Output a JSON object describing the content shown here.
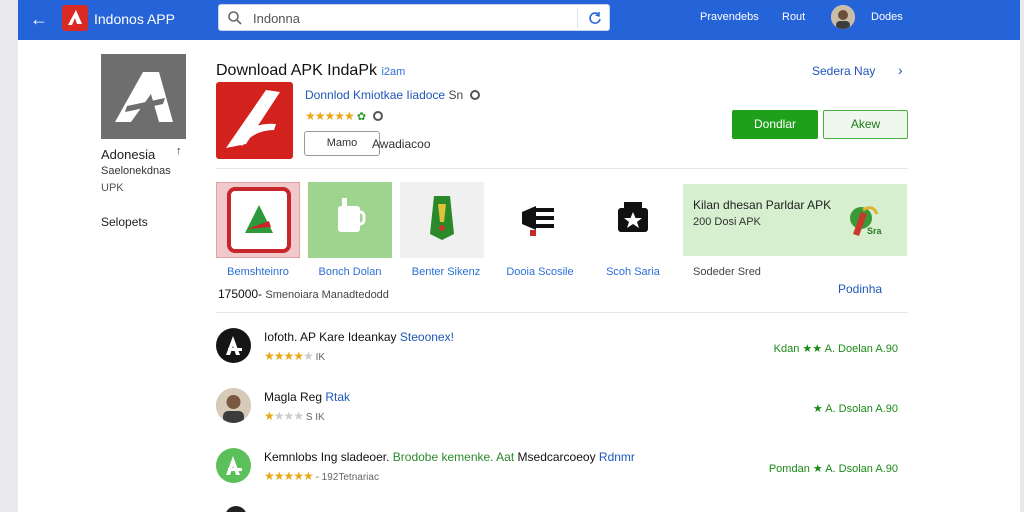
{
  "topbar": {
    "app_name": "Indonos APP",
    "search_value": "Indonna",
    "link_1": "Pravendebs",
    "link_2": "Rout",
    "user_name": "Dodes"
  },
  "sidebar": {
    "title": "Adonesia",
    "sub_1": "Saelonekdnas",
    "sub_2": "UPK",
    "item": "Selopets"
  },
  "header": {
    "title": "Download APK IndaPk",
    "title_tag": "i2am",
    "subtitle": "Donnlod Kmiotkae Iiadoce",
    "subtitle_suffix": "Sn",
    "chip": "Mamo",
    "chip_note": "Awadiacoo",
    "similar": "Sedera Nay",
    "download_button": "Dondlar",
    "alt_button": "Akew"
  },
  "tiles": [
    {
      "label": "Bemshteinro"
    },
    {
      "label": "Bonch Dolan"
    },
    {
      "label": "Benter Sikenz"
    },
    {
      "label": "Dooia Scosile"
    },
    {
      "label": "Scoh Saria"
    },
    {
      "label": "Sodeder Sred"
    }
  ],
  "promo": {
    "title": "Kilan dhesan Parldar APK",
    "sub": "200 Dosi APK",
    "badge": "Sra"
  },
  "counts": {
    "number": "1750",
    "suffix": "00-",
    "text": "Smenoiara Manadtedodd",
    "more": "Podinha"
  },
  "list": [
    {
      "title": "Iofoth. AP Kare Ideankay",
      "link": "Steoonex!",
      "meta": "IK",
      "rating": 4,
      "right_label": "Kdan",
      "right_version": "A. Doelan A.90"
    },
    {
      "title": "Magla Reg",
      "link": "Rtak",
      "meta": "S IK",
      "rating": 1,
      "right_label": "",
      "right_version": "A. Dsolan A.90"
    },
    {
      "title": "Kemnlobs Ing sladeoer.",
      "link": "Brodobe kemenke. Aat",
      "link2": "Msedcarcoeoy",
      "link3": "Rdnmr",
      "meta": "- 192Tetnariac",
      "rating": 5,
      "right_label": "Pomdan",
      "right_version": "A. Dsolan A.90"
    }
  ],
  "colors": {
    "topbar": "#2563d8",
    "brand_red": "#d3221e",
    "download_green": "#1fa01a",
    "link_blue": "#1f57b8"
  }
}
